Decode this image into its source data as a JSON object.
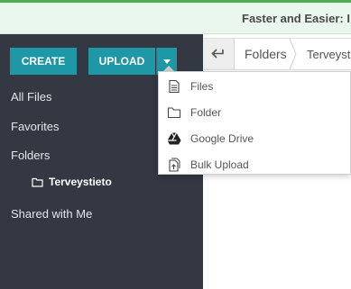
{
  "banner": {
    "text": "Faster and Easier: I"
  },
  "sidebar": {
    "create_label": "CREATE",
    "upload_label": "UPLOAD",
    "items": [
      {
        "label": "All Files"
      },
      {
        "label": "Favorites"
      },
      {
        "label": "Folders"
      },
      {
        "label": "Terveystieto"
      },
      {
        "label": "Shared with Me"
      }
    ]
  },
  "breadcrumb": {
    "items": [
      {
        "label": "Folders"
      },
      {
        "label": "Terveystie"
      }
    ]
  },
  "upload_menu": {
    "items": [
      {
        "label": "Files",
        "icon": "file-icon"
      },
      {
        "label": "Folder",
        "icon": "folder-icon"
      },
      {
        "label": "Google Drive",
        "icon": "google-drive-icon"
      },
      {
        "label": "Bulk Upload",
        "icon": "bulk-upload-icon"
      }
    ]
  },
  "colors": {
    "sidebar_bg": "#333842",
    "button_accent": "#1e98a6",
    "banner_bg": "#eaf7ee",
    "top_strip": "#4caf50"
  }
}
